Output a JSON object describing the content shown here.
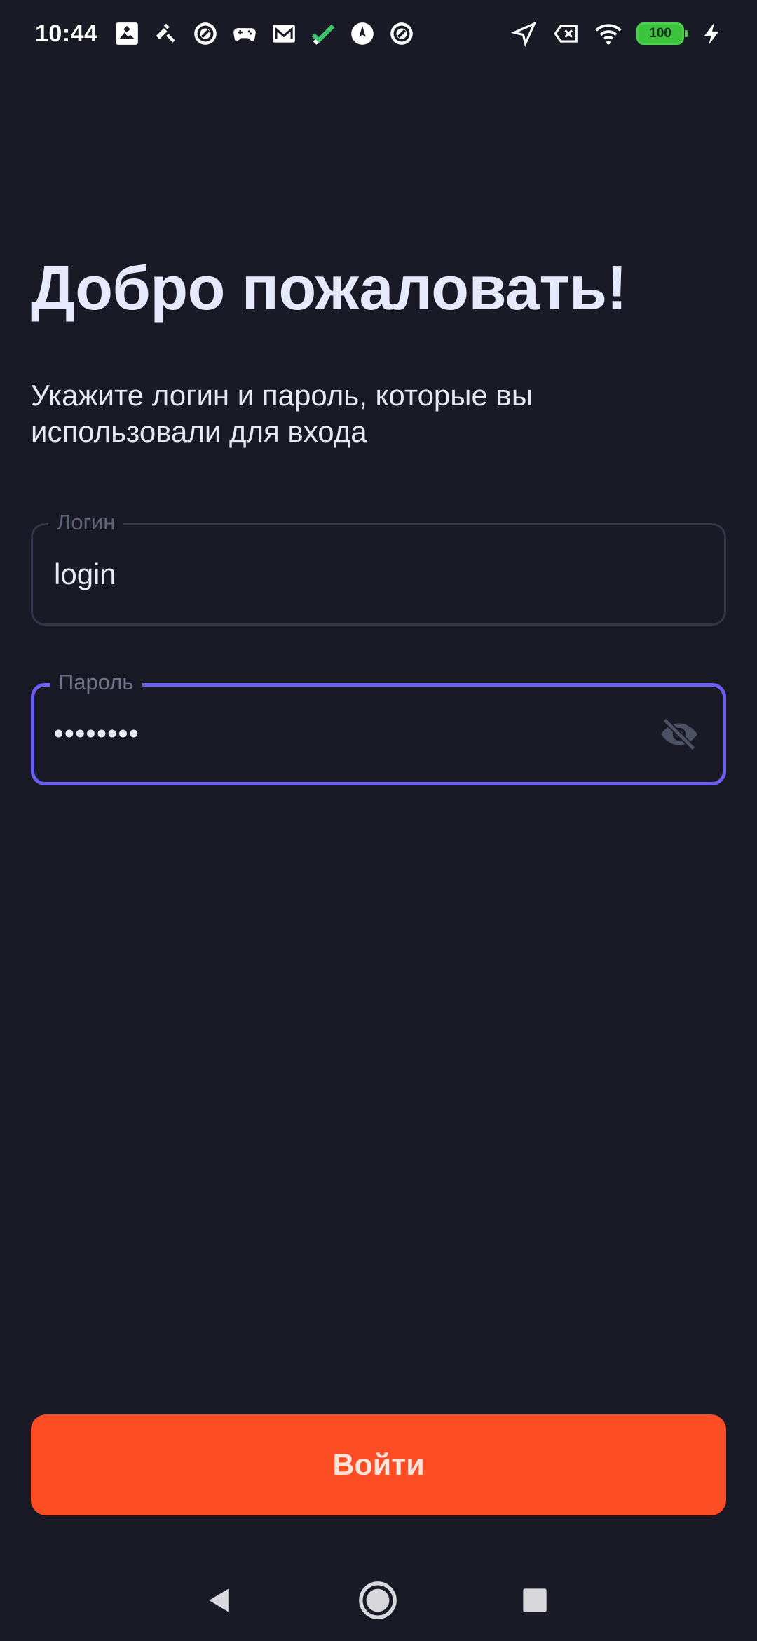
{
  "status_bar": {
    "time": "10:44",
    "notification_icons": [
      "image-icon",
      "tool-icon",
      "at-sign-icon",
      "gamepad-icon",
      "mail-icon",
      "check-icon",
      "compass-icon",
      "at-sign-icon"
    ],
    "right_icons": [
      "location-arrow-icon",
      "sim-x-icon",
      "wifi-icon",
      "battery-icon",
      "charging-bolt-icon"
    ],
    "battery_level": "100",
    "battery_color": "#3bc43b"
  },
  "welcome": {
    "title": "Добро пожаловать!",
    "subtitle": "Укажите логин и пароль, которые вы использовали для входа"
  },
  "login_field": {
    "label": "Логин",
    "value": "login"
  },
  "password_field": {
    "label": "Пароль",
    "value": "••••••••",
    "focus_color": "#6a5ff0",
    "toggle_icon": "eye-off-icon"
  },
  "submit_button": {
    "label": "Войти",
    "color": "#fd4d24"
  },
  "nav_bar": {
    "icons": [
      "back-triangle-icon",
      "home-circle-icon",
      "recents-square-icon"
    ]
  },
  "colors": {
    "background": "#1a1a26",
    "text_primary": "#e6e9fb",
    "label_muted": "#5d6276"
  }
}
